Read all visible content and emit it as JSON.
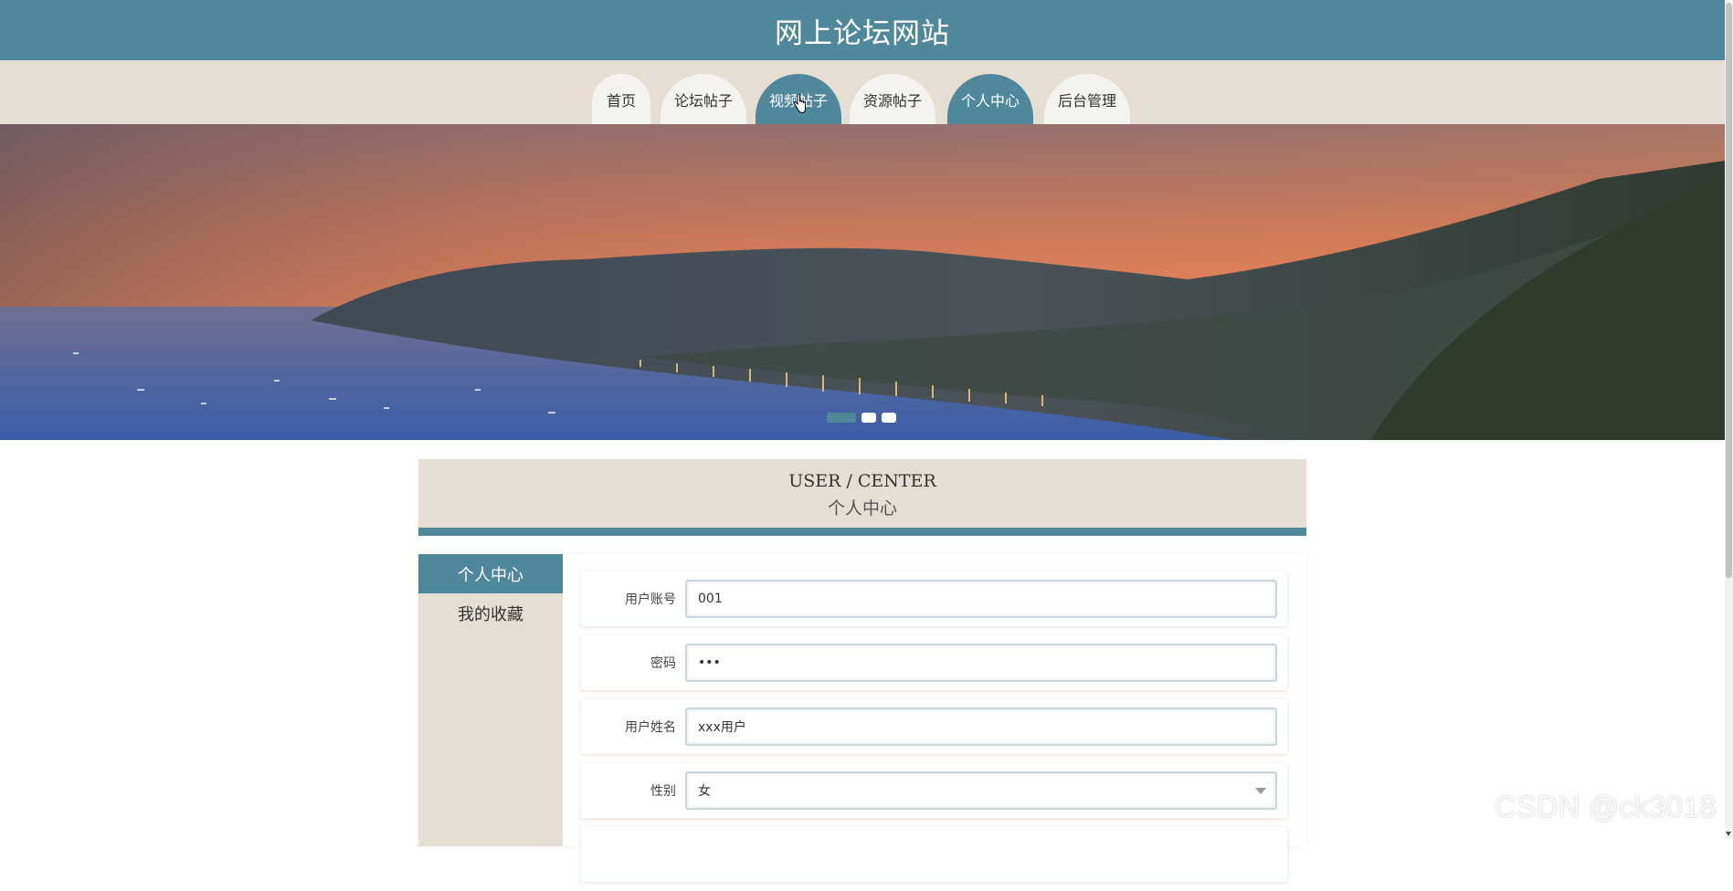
{
  "header": {
    "title": "网上论坛网站"
  },
  "nav": {
    "items": [
      {
        "label": "首页",
        "active": false
      },
      {
        "label": "论坛帖子",
        "active": false
      },
      {
        "label": "视频帖子",
        "active": true
      },
      {
        "label": "资源帖子",
        "active": false
      },
      {
        "label": "个人中心",
        "active": true
      },
      {
        "label": "后台管理",
        "active": false
      }
    ]
  },
  "banner": {
    "slide_count": 3,
    "active_slide": 1
  },
  "section": {
    "title_en": "USER / CENTER",
    "title_cn": "个人中心"
  },
  "side_menu": {
    "items": [
      {
        "label": "个人中心",
        "active": true
      },
      {
        "label": "我的收藏",
        "active": false
      }
    ]
  },
  "form": {
    "fields": [
      {
        "label": "用户账号",
        "value": "001",
        "type": "text"
      },
      {
        "label": "密码",
        "value": "•••",
        "type": "password"
      },
      {
        "label": "用户姓名",
        "value": "xxx用户",
        "type": "text"
      },
      {
        "label": "性别",
        "value": "女",
        "type": "select"
      }
    ]
  },
  "watermark": "CSDN @ck3018",
  "colors": {
    "primary": "#50879b",
    "beige": "#e6ded3"
  }
}
